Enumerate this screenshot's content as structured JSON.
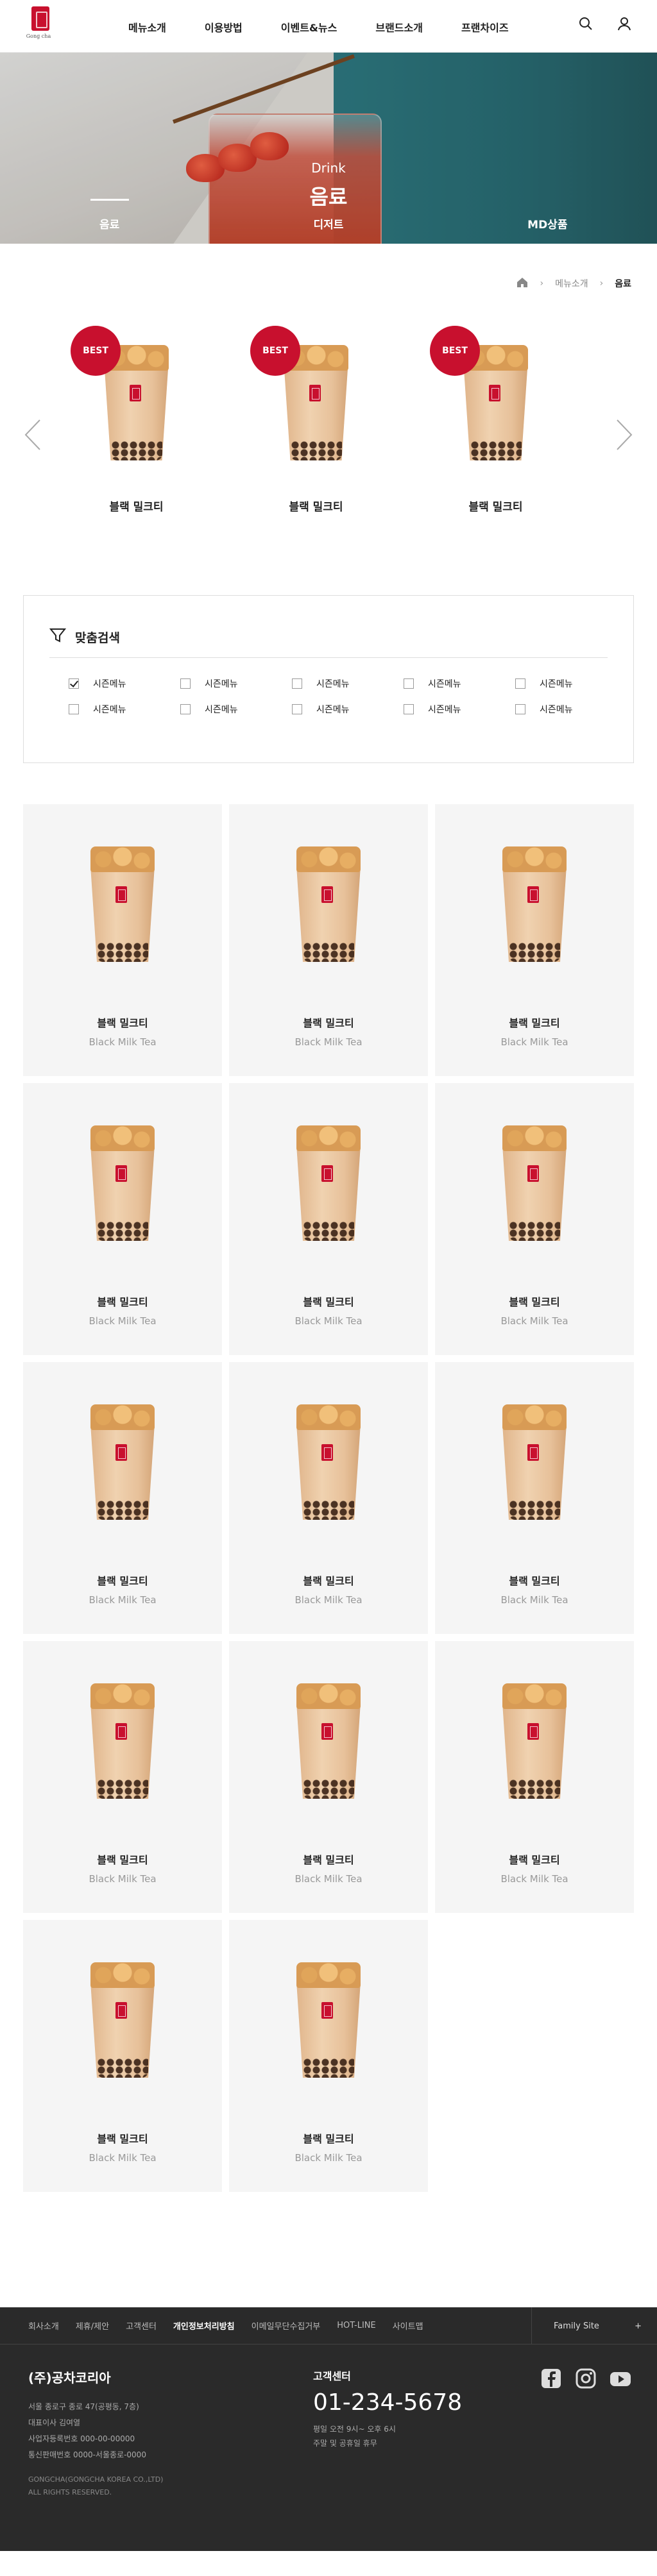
{
  "header": {
    "logo_text": "Gong cha",
    "nav": [
      "메뉴소개",
      "이용방법",
      "이벤트&뉴스",
      "브랜드소개",
      "프랜차이즈"
    ]
  },
  "hero": {
    "category_en": "Drink",
    "category_ko": "음료",
    "tabs": [
      "음료",
      "디저트",
      "MD상품"
    ],
    "active_tab": 0
  },
  "breadcrumb": {
    "items": [
      "메뉴소개",
      "음료"
    ]
  },
  "best": {
    "badge": "BEST",
    "items": [
      {
        "name": "블랙 밀크티"
      },
      {
        "name": "블랙 밀크티"
      },
      {
        "name": "블랙 밀크티"
      }
    ]
  },
  "filter": {
    "title": "맞춤검색",
    "options": [
      {
        "label": "시즌메뉴",
        "checked": true
      },
      {
        "label": "시즌메뉴",
        "checked": false
      },
      {
        "label": "시즌메뉴",
        "checked": false
      },
      {
        "label": "시즌메뉴",
        "checked": false
      },
      {
        "label": "시즌메뉴",
        "checked": false
      },
      {
        "label": "시즌메뉴",
        "checked": false
      },
      {
        "label": "시즌메뉴",
        "checked": false
      },
      {
        "label": "시즌메뉴",
        "checked": false
      },
      {
        "label": "시즌메뉴",
        "checked": false
      },
      {
        "label": "시즌메뉴",
        "checked": false
      }
    ]
  },
  "products": [
    {
      "name": "블랙 밀크티",
      "name_en": "Black Milk Tea"
    },
    {
      "name": "블랙 밀크티",
      "name_en": "Black Milk Tea"
    },
    {
      "name": "블랙 밀크티",
      "name_en": "Black Milk Tea"
    },
    {
      "name": "블랙 밀크티",
      "name_en": "Black Milk Tea"
    },
    {
      "name": "블랙 밀크티",
      "name_en": "Black Milk Tea"
    },
    {
      "name": "블랙 밀크티",
      "name_en": "Black Milk Tea"
    },
    {
      "name": "블랙 밀크티",
      "name_en": "Black Milk Tea"
    },
    {
      "name": "블랙 밀크티",
      "name_en": "Black Milk Tea"
    },
    {
      "name": "블랙 밀크티",
      "name_en": "Black Milk Tea"
    },
    {
      "name": "블랙 밀크티",
      "name_en": "Black Milk Tea"
    },
    {
      "name": "블랙 밀크티",
      "name_en": "Black Milk Tea"
    },
    {
      "name": "블랙 밀크티",
      "name_en": "Black Milk Tea"
    },
    {
      "name": "블랙 밀크티",
      "name_en": "Black Milk Tea"
    },
    {
      "name": "블랙 밀크티",
      "name_en": "Black Milk Tea"
    }
  ],
  "footer": {
    "links": [
      "회사소개",
      "제휴/제안",
      "고객센터",
      "개인정보처리방침",
      "이메일무단수집거부",
      "HOT-LINE",
      "사이트맵"
    ],
    "family_site": "Family Site",
    "family_plus": "+",
    "company_name": "(주)공차코리아",
    "info": [
      "서울 종로구 종로 47(공평동, 7층)",
      "대표이사 김여열",
      "사업자등록번호 000-00-00000",
      "통신판매번호 0000-서울종로-0000"
    ],
    "copyright": [
      "GONGCHA(GONGCHA KOREA CO.,LTD)",
      "ALL RIGHTS RESERVED."
    ],
    "cs_label": "고객센터",
    "cs_phone": "01-234-5678",
    "cs_hours": [
      "평일 오전 9시~ 오후 6시",
      "주말 및 공휴일 휴무"
    ],
    "sns": [
      "facebook-icon",
      "instagram-icon",
      "youtube-icon"
    ]
  },
  "colors": {
    "brand_red": "#c8102e",
    "footer_bg": "#2a2a2a",
    "card_bg": "#f5f5f5"
  }
}
